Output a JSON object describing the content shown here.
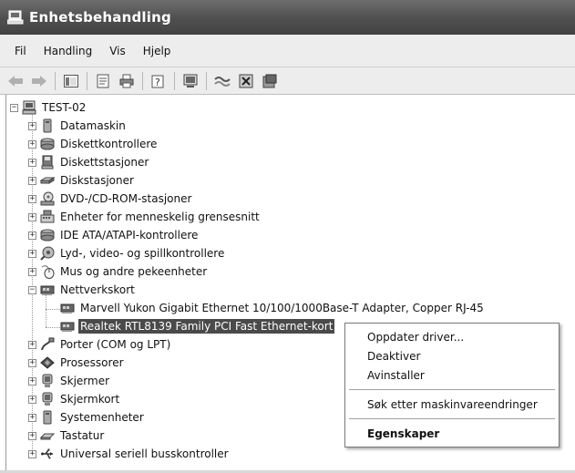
{
  "window": {
    "title": "Enhetsbehandling",
    "icon": "device-manager-icon"
  },
  "menubar": {
    "items": [
      "Fil",
      "Handling",
      "Vis",
      "Hjelp"
    ]
  },
  "toolbar": {
    "buttons": [
      {
        "name": "back-icon",
        "glyph": "⇦",
        "enabled": false
      },
      {
        "name": "forward-icon",
        "glyph": "⇨",
        "enabled": false
      },
      {
        "name": "show-hide-console-tree-icon",
        "glyph": "▣",
        "enabled": true
      },
      {
        "name": "properties-icon",
        "glyph": "▤",
        "enabled": true
      },
      {
        "name": "print-icon",
        "glyph": "⎙",
        "enabled": true
      },
      {
        "name": "help-icon",
        "glyph": "?",
        "enabled": true
      },
      {
        "name": "scan-hardware-icon",
        "glyph": "▦",
        "enabled": true
      },
      {
        "name": "update-driver-icon",
        "glyph": "≈",
        "enabled": true
      },
      {
        "name": "disable-device-icon",
        "glyph": "✕",
        "enabled": true
      },
      {
        "name": "uninstall-device-icon",
        "glyph": "▩",
        "enabled": true
      }
    ]
  },
  "tree": {
    "root": {
      "label": "TEST-02",
      "icon": "computer-icon",
      "expanded": true
    },
    "categories": [
      {
        "label": "Datamaskin",
        "icon": "computer-icon"
      },
      {
        "label": "Diskettkontrollere",
        "icon": "disk-controller-icon"
      },
      {
        "label": "Diskettstasjoner",
        "icon": "floppy-drive-icon"
      },
      {
        "label": "Diskstasjoner",
        "icon": "hard-disk-icon"
      },
      {
        "label": "DVD-/CD-ROM-stasjoner",
        "icon": "dvd-drive-icon"
      },
      {
        "label": "Enheter for menneskelig grensesnitt",
        "icon": "hid-icon"
      },
      {
        "label": "IDE ATA/ATAPI-kontrollere",
        "icon": "ide-controller-icon"
      },
      {
        "label": "Lyd-, video- og spillkontrollere",
        "icon": "sound-icon"
      },
      {
        "label": "Mus og andre pekeenheter",
        "icon": "mouse-icon"
      },
      {
        "label": "Nettverkskort",
        "icon": "network-card-icon",
        "expanded": true,
        "children": [
          {
            "label": "Marvell Yukon Gigabit Ethernet 10/100/1000Base-T Adapter, Copper RJ-45",
            "icon": "network-card-icon"
          },
          {
            "label": "Realtek RTL8139 Family PCI Fast Ethernet-kort",
            "icon": "network-card-icon",
            "selected": true
          }
        ]
      },
      {
        "label": "Porter (COM og LPT)",
        "icon": "port-icon"
      },
      {
        "label": "Prosessorer",
        "icon": "processor-icon"
      },
      {
        "label": "Skjermer",
        "icon": "monitor-icon"
      },
      {
        "label": "Skjermkort",
        "icon": "display-adapter-icon"
      },
      {
        "label": "Systemenheter",
        "icon": "system-device-icon"
      },
      {
        "label": "Tastatur",
        "icon": "keyboard-icon"
      },
      {
        "label": "Universal seriell busskontroller",
        "icon": "usb-icon"
      }
    ]
  },
  "context_menu": {
    "items": [
      {
        "label": "Oppdater driver...",
        "bold": false
      },
      {
        "label": "Deaktiver",
        "bold": false
      },
      {
        "label": "Avinstaller",
        "bold": false
      },
      {
        "separator": true
      },
      {
        "label": "Søk etter maskinvareendringer",
        "bold": false
      },
      {
        "separator": true
      },
      {
        "label": "Egenskaper",
        "bold": true
      }
    ]
  },
  "colors": {
    "titlebar": "#555555",
    "selection": "#4a4a4a",
    "menu_background": "#ededed"
  }
}
